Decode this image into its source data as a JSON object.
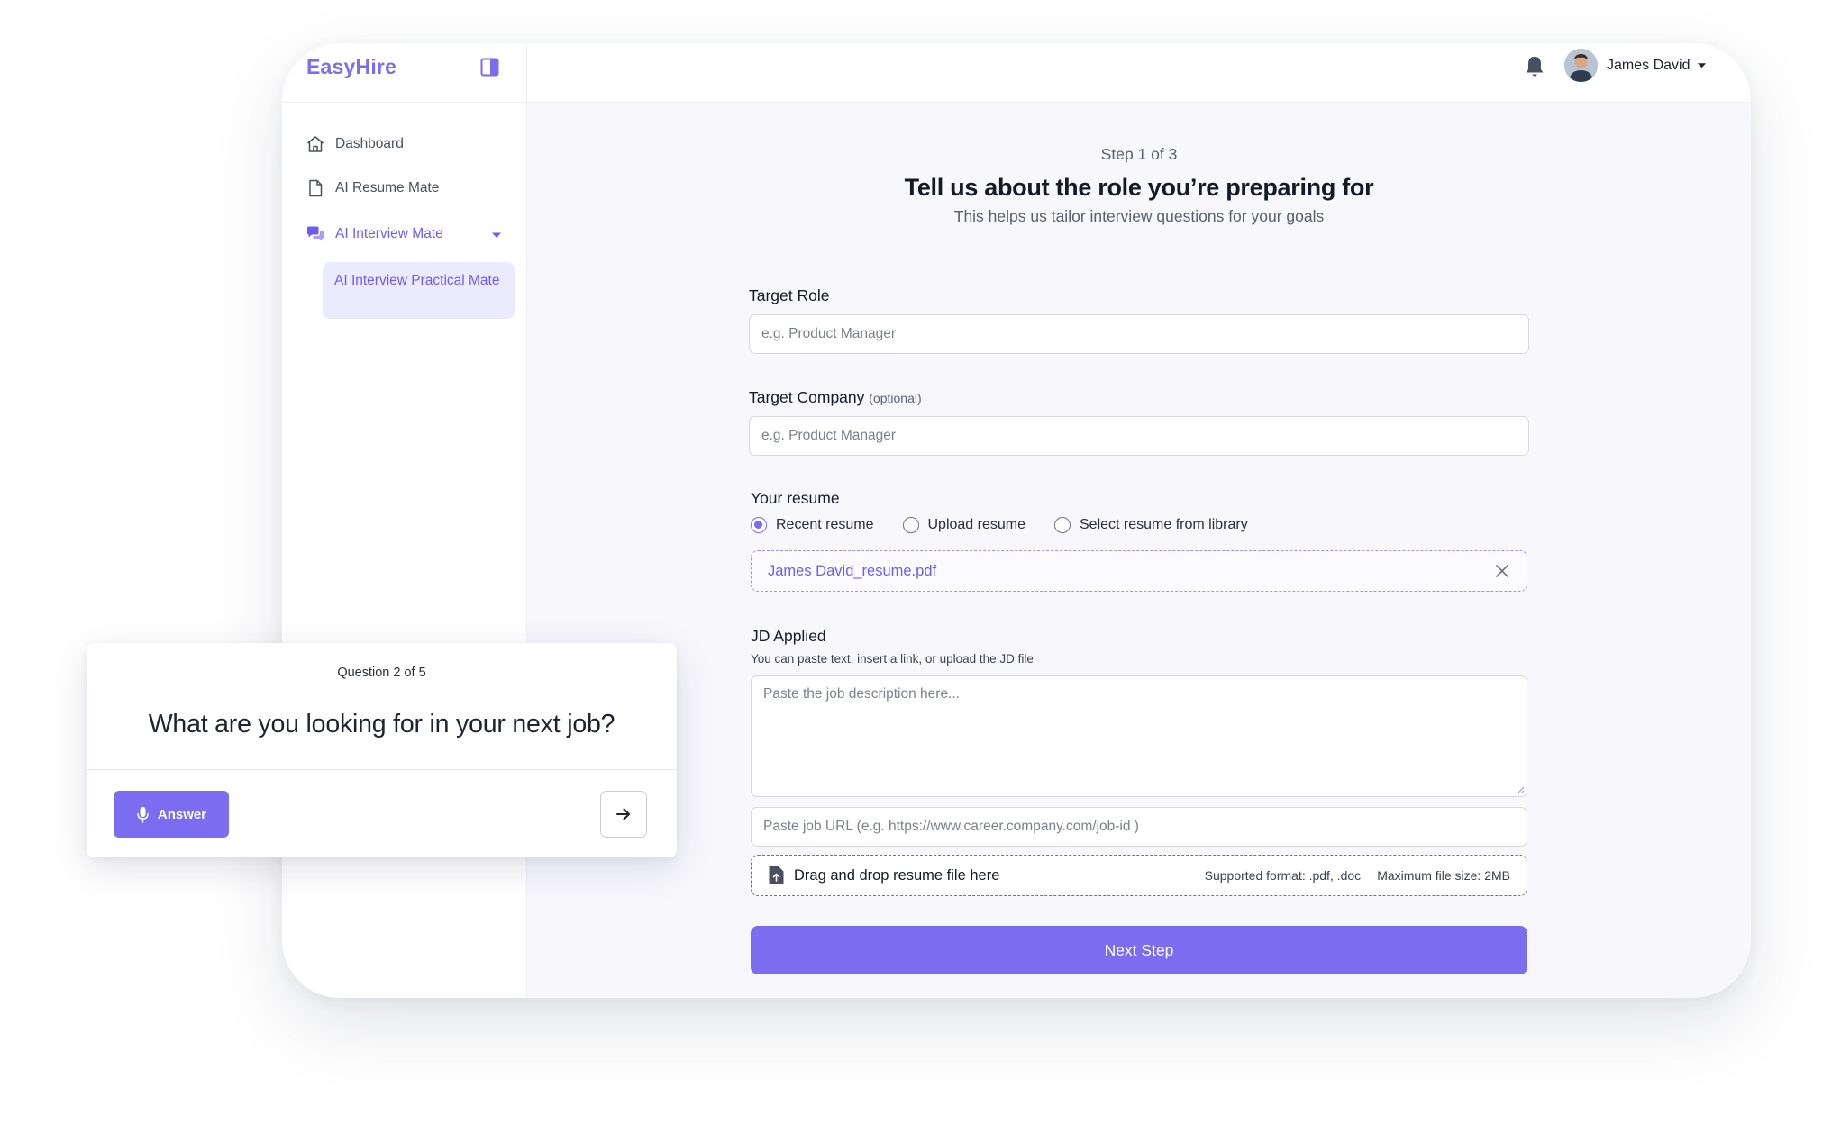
{
  "app": {
    "brand": "EasyHire",
    "accent_color": "#7b6cf0"
  },
  "sidebar": {
    "items": [
      {
        "label": "Dashboard",
        "icon": "home-icon"
      },
      {
        "label": "AI Resume Mate",
        "icon": "document-icon"
      },
      {
        "label": "AI Interview Mate",
        "icon": "chat-bubbles-icon",
        "active": true,
        "expanded": true
      }
    ],
    "sub_items": [
      {
        "label": "AI Interview Practical Mate",
        "selected": true
      }
    ]
  },
  "header": {
    "user_name": "James David"
  },
  "form": {
    "step": "Step 1 of 3",
    "title": "Tell us about the role you’re preparing for",
    "subtitle": "This helps us tailor interview questions for your goals",
    "target_role": {
      "label": "Target Role",
      "placeholder": "e.g. Product Manager",
      "value": ""
    },
    "target_company": {
      "label": "Target Company",
      "optional_note": "(optional)",
      "placeholder": "e.g. Product Manager",
      "value": ""
    },
    "resume": {
      "label": "Your resume",
      "options": [
        "Recent resume",
        "Upload resume",
        "Select resume from library"
      ],
      "selected": "Recent resume",
      "file_name": "James David_resume.pdf"
    },
    "jd": {
      "label": "JD Applied",
      "hint": "You can paste text, insert a link, or upload the JD file",
      "text_placeholder": "Paste the job description here...",
      "url_placeholder": "Paste job URL (e.g. https://www.career.company.com/job-id )",
      "dropzone_label": "Drag and drop resume file here",
      "supported_format": "Supported format: .pdf, .doc",
      "max_size": "Maximum file size: 2MB"
    },
    "next_button": "Next Step"
  },
  "question_card": {
    "counter": "Question 2 of 5",
    "question": "What are you looking for in your next job?",
    "answer_button": "Answer"
  }
}
